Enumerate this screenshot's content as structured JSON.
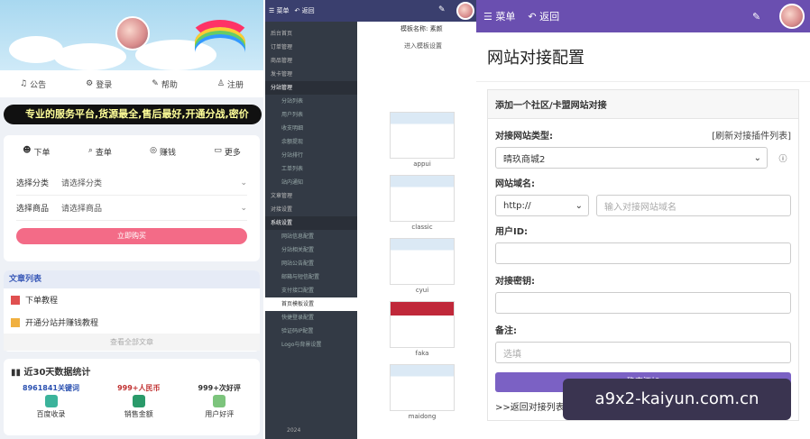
{
  "mobile": {
    "nav": [
      "公告",
      "登录",
      "帮助",
      "注册"
    ],
    "marquee": "专业的服务平台,货源最全,售后最好,开通分战,密价",
    "tabs": [
      "下单",
      "查单",
      "赚钱",
      "更多"
    ],
    "form": [
      {
        "label": "选择分类",
        "value": "请选择分类"
      },
      {
        "label": "选择商品",
        "value": "请选择商品"
      }
    ],
    "buy_label": "立即购买",
    "articles_title": "文章列表",
    "articles": [
      {
        "title": "下单教程",
        "color": "#e05050"
      },
      {
        "title": "开通分站并赚钱教程",
        "color": "#f0b040"
      }
    ],
    "more_articles": "查看全部文章",
    "stats_title": "近30天数据统计",
    "stats": [
      {
        "value": "8961841关键词",
        "label": "百度收录",
        "color": "#2a50b0"
      },
      {
        "value": "999+人民币",
        "label": "销售金额",
        "color": "#c03030"
      },
      {
        "value": "999+次好评",
        "label": "用户好评",
        "color": "#333"
      }
    ]
  },
  "admin": {
    "menu_label": "菜单",
    "back_label": "返回",
    "template_name": "模板名称: 素颜",
    "template_link": "进入模板设置",
    "menu": [
      {
        "label": "后台首页",
        "t": "mi"
      },
      {
        "label": "订单管理",
        "t": "mi"
      },
      {
        "label": "商品管理",
        "t": "mi"
      },
      {
        "label": "发卡管理",
        "t": "mi"
      },
      {
        "label": "分站管理",
        "t": "mi sec"
      },
      {
        "label": "分站列表",
        "t": "mi sub"
      },
      {
        "label": "用户列表",
        "t": "mi sub"
      },
      {
        "label": "收支明细",
        "t": "mi sub"
      },
      {
        "label": "余额提现",
        "t": "mi sub"
      },
      {
        "label": "分站排行",
        "t": "mi sub"
      },
      {
        "label": "工单列表",
        "t": "mi sub"
      },
      {
        "label": "站内通知",
        "t": "mi sub"
      },
      {
        "label": "文章管理",
        "t": "mi"
      },
      {
        "label": "对接设置",
        "t": "mi"
      },
      {
        "label": "系统设置",
        "t": "mi sec"
      },
      {
        "label": "网站信息配置",
        "t": "mi sub"
      },
      {
        "label": "分站相关配置",
        "t": "mi sub"
      },
      {
        "label": "网站公告配置",
        "t": "mi sub"
      },
      {
        "label": "邮箱与短信配置",
        "t": "mi sub"
      },
      {
        "label": "支付接口配置",
        "t": "mi sub"
      },
      {
        "label": "首页模板设置",
        "t": "mi sub act"
      },
      {
        "label": "快捷登录配置",
        "t": "mi sub"
      },
      {
        "label": "验证码IP配置",
        "t": "mi sub"
      },
      {
        "label": "Logo与背景设置",
        "t": "mi sub"
      }
    ],
    "templates": [
      "appui",
      "classic",
      "cyui",
      "faka",
      "maidong"
    ],
    "footer": "2024"
  },
  "config": {
    "menu_label": "菜单",
    "back_label": "返回",
    "page_title": "网站对接配置",
    "section_title": "添加一个社区/卡盟网站对接",
    "type_label": "对接网站类型:",
    "refresh_link": "[刷新对接插件列表]",
    "type_value": "晴玖商城2",
    "domain_label": "网站域名:",
    "protocol": "http://",
    "domain_placeholder": "输入对接网站域名",
    "userid_label": "用户ID:",
    "key_label": "对接密钥:",
    "remark_label": "备注:",
    "remark_placeholder": "选填",
    "submit_label": "确定添加",
    "back_link": ">>返回对接列表"
  },
  "watermark": "a9x2-kaiyun.com.cn"
}
